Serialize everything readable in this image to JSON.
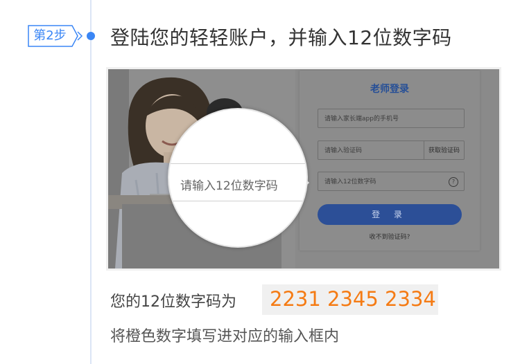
{
  "step": {
    "badge": "第2步",
    "title": "登陆您的轻轻账户，并输入12位数字码"
  },
  "screenshot": {
    "login_title": "老师登录",
    "phone_placeholder": "请输入家长端app的手机号",
    "verify_placeholder": "请输入验证码",
    "get_code_button": "获取验证码",
    "code12_placeholder": "请输入12位数字码",
    "help_icon": "?",
    "login_button": "登 录",
    "no_code_link": "收不到验证码?",
    "magnifier_text": "请输入12位数字码"
  },
  "instruction": {
    "code_label": "您的12位数字码为",
    "code_value": "2231 2345 2334",
    "hint": "将橙色数字填写进对应的输入框内"
  },
  "colors": {
    "accent": "#3a86f5",
    "code": "#f57b14",
    "login_button": "#2c4f97"
  }
}
